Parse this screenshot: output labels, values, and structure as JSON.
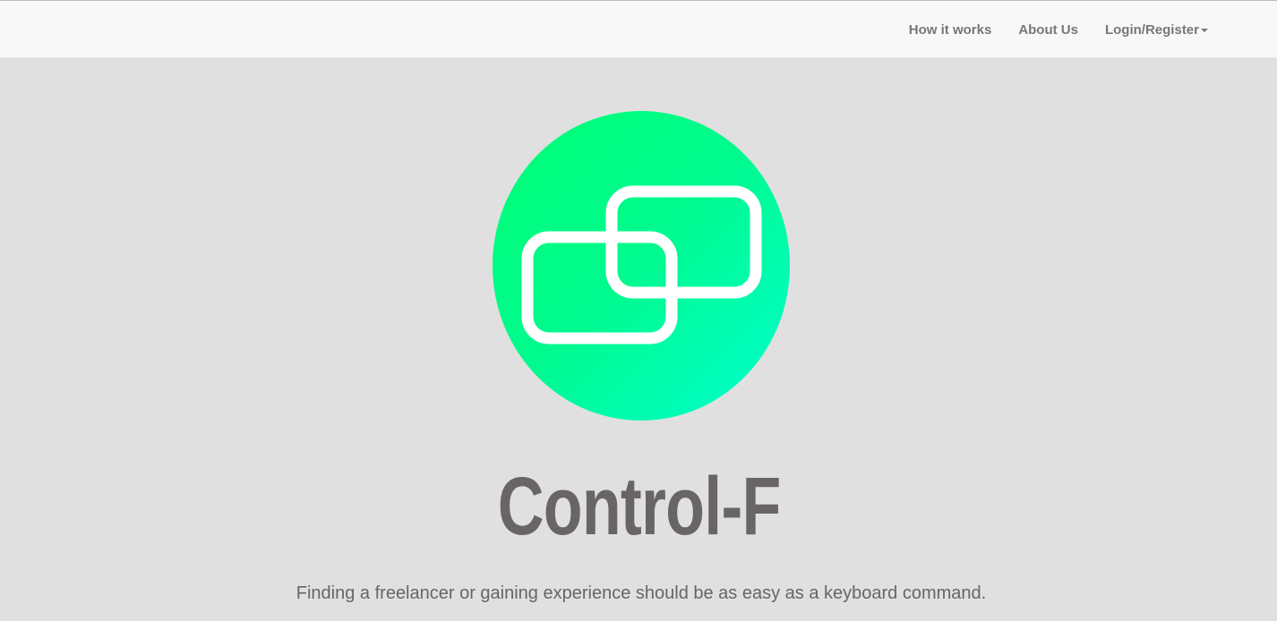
{
  "nav": {
    "items": [
      {
        "label": "How it works"
      },
      {
        "label": "About Us"
      },
      {
        "label": "Login/Register"
      }
    ]
  },
  "hero": {
    "logo_icon": "overlapping-rectangles-logo",
    "title": "Control-F",
    "subtitle": "Finding a freelancer or gaining experience should be as easy as a keyboard command."
  },
  "colors": {
    "background": "#e0e0e0",
    "navbar": "#f8f8f8",
    "nav_text": "#777777",
    "logo_gradient_start": "#00ff7a",
    "logo_gradient_end": "#00ffcc",
    "text": "#686564"
  }
}
